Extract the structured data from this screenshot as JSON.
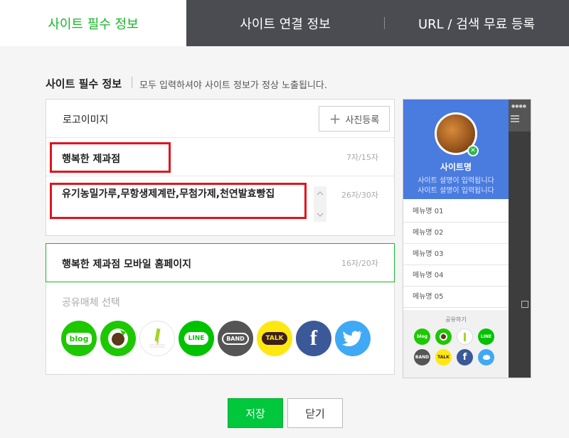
{
  "tabs": [
    {
      "label": "사이트 필수 정보",
      "active": true
    },
    {
      "label": "사이트 연결 정보",
      "active": false
    },
    {
      "label": "URL / 검색 무료 등록",
      "active": false
    }
  ],
  "section": {
    "title": "사이트 필수 정보",
    "description": "모두 입력하셔야 사이트 정보가 정상 노출됩니다."
  },
  "logo": {
    "label": "로고이미지",
    "photo_button": "사진등록"
  },
  "site_name": {
    "value": "행복한 제과점",
    "count": "7자/15자"
  },
  "site_description": {
    "value": "유기농밀가루,무항생제계란,무첨가제,천연발효빵집",
    "count": "26자/30자"
  },
  "mobile_homepage": {
    "value": "행복한 제과점 모바일 홈페이지",
    "count": "16자/20자"
  },
  "share": {
    "label": "공유매체 선택",
    "icons": [
      {
        "name": "blog",
        "label": "blog",
        "color": "#1ec800"
      },
      {
        "name": "cafe",
        "label": "",
        "color": "#1ec800"
      },
      {
        "name": "memo",
        "label": "",
        "color": "#ffffff"
      },
      {
        "name": "line",
        "label": "LINE",
        "color": "#00c300"
      },
      {
        "name": "band",
        "label": "BAND",
        "color": "#555555"
      },
      {
        "name": "kakaotalk",
        "label": "TALK",
        "color": "#ffe812"
      },
      {
        "name": "facebook",
        "label": "f",
        "color": "#3b5998"
      },
      {
        "name": "twitter",
        "label": "",
        "color": "#3fa9f5"
      }
    ]
  },
  "preview": {
    "site_name": "사이트명",
    "desc_line1": "사이트 설명이 입력됩니다",
    "desc_line2": "사이트 설명이 입력됩니다",
    "menus": [
      "메뉴명 01",
      "메뉴명 02",
      "메뉴명 03",
      "메뉴명 04",
      "메뉴명 05"
    ],
    "share_label": "공유하기"
  },
  "buttons": {
    "save": "저장",
    "close": "닫기"
  },
  "colors": {
    "accent": "#17b628",
    "tab_dark": "#4a4c52",
    "highlight": "#e0141e",
    "preview_header": "#4a7bdf"
  }
}
